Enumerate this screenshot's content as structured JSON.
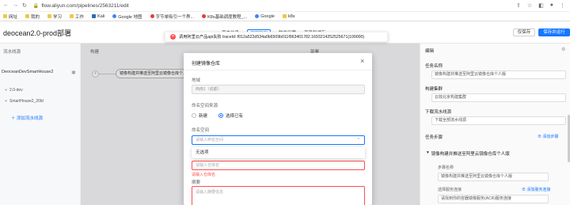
{
  "browser": {
    "url": "flow.aliyun.com/pipelines/2563211/edit",
    "bookmarks": [
      {
        "label": "网址",
        "icon": "folder-icon"
      },
      {
        "label": "我的",
        "icon": "folder-icon"
      },
      {
        "label": "学习",
        "icon": "folder-icon"
      },
      {
        "label": "工作",
        "icon": "folder-icon"
      },
      {
        "label": "Kali",
        "icon": "kali-icon"
      },
      {
        "label": "Google 地图",
        "icon": "google-icon"
      },
      {
        "label": "字节单吸引一个界...",
        "icon": "page-icon"
      },
      {
        "label": "K8s基础调度教程_...",
        "icon": "page-icon"
      },
      {
        "label": "Google",
        "icon": "google-icon"
      },
      {
        "label": "k8s",
        "icon": "folder-icon"
      }
    ]
  },
  "header": {
    "title": "deocean2.0-prod部署",
    "tabs": [
      "基本信息",
      "流程配置",
      "触发设置",
      "变量和缓存"
    ],
    "active_tab": 1,
    "save_label": "仅保存",
    "run_label": "保存并运行"
  },
  "toast": {
    "message": "调用阿里云产品api失败 traceId: f012a522d534a0b6509b011f963401782.1693214252525671(100000)"
  },
  "pipeline": {
    "col_source": "流水线源",
    "col_build": "构建",
    "repo": "DeoceanDevSmartHouse2",
    "branches": [
      "2.0-dev",
      "SmartHouse2_20ld"
    ],
    "add_source": "添加流水线源",
    "task_node": "镜像构建并推送至阿里云镜像仓库个人版",
    "col_deploy": "部署"
  },
  "modal": {
    "title": "创建镜像仓库",
    "region_label": "地域",
    "region_value": "西南1（成都）",
    "ns_source_label": "命名空间来源",
    "radio_new": "新建",
    "radio_existing": "选择已有",
    "ns_label": "命名空间",
    "ns_placeholder": "请输入命名空间",
    "dropdown_empty": "无选项",
    "repo_name_placeholder": "请输入仓库名",
    "repo_name_error": "请输入仓库名",
    "summary_label": "摘要",
    "summary_placeholder": "请输入摘要信息"
  },
  "right_panel": {
    "tab": "编辑",
    "task_name_label": "任务名称",
    "task_name_value": "镜像构建并推送至阿里云镜像仓库个人版",
    "build_cluster_label": "构建集群",
    "build_cluster_value": "云效北京构建集群",
    "download_label": "下载流水线源",
    "download_value": "下载全部流水线源",
    "steps_label": "任务步骤",
    "add_step": "添加步骤",
    "step_name": "镜像构建并推送至阿里云镜像仓库个人版",
    "step_name_label": "步骤名称",
    "step_name_value": "镜像构建并推送至阿里云镜像仓库个人版",
    "service_conn_label": "选择服务连接",
    "add_service_conn": "添加服务连接",
    "service_conn_value": "请找到你的容器镜像服务(ACR)服务连接"
  }
}
